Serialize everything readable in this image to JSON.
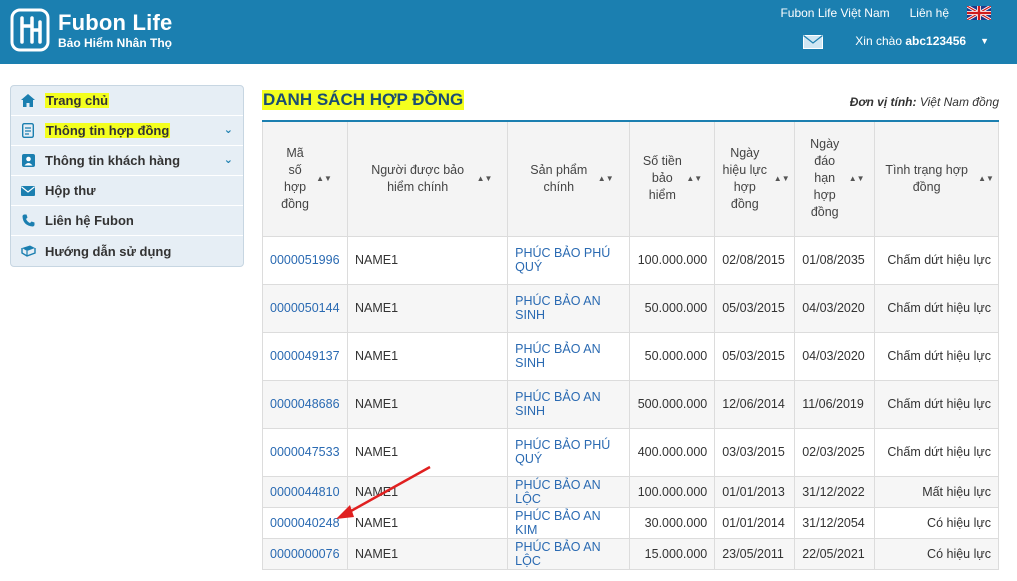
{
  "header": {
    "brand": "Fubon Life",
    "tagline": "Bảo Hiểm Nhân Thọ",
    "company_link": "Fubon Life Việt Nam",
    "contact_link": "Liên hệ",
    "greeting": "Xin chào",
    "username": "abc123456",
    "icons": {
      "logo": "fubon-logo",
      "flag": "uk-flag-icon",
      "mail": "mail-icon",
      "dropdown": "caret-down-icon"
    }
  },
  "sidebar": {
    "items": [
      {
        "label": "Trang chủ",
        "icon": "home-icon"
      },
      {
        "label": "Thông tin hợp đồng",
        "icon": "document-icon"
      },
      {
        "label": "Thông tin khách hàng",
        "icon": "user-icon"
      },
      {
        "label": "Hộp thư",
        "icon": "mail-icon"
      },
      {
        "label": "Liên hệ Fubon",
        "icon": "phone-icon"
      },
      {
        "label": "Hướng dẫn sử dụng",
        "icon": "book-icon"
      }
    ]
  },
  "main": {
    "title": "DANH SÁCH HỢP ĐỒNG",
    "unit_label": "Đơn vị tính:",
    "unit_value": "Việt Nam đồng"
  },
  "table": {
    "columns": [
      "Mã số hợp đồng",
      "Người được bảo hiểm chính",
      "Sản phẩm chính",
      "Số tiền bảo hiểm",
      "Ngày hiệu lực hợp đồng",
      "Ngày đáo hạn hợp đồng",
      "Tình trạng hợp đồng"
    ],
    "rows": [
      [
        "0000051996",
        "NAME1",
        "PHÚC BẢO PHÚ QUÝ",
        "100.000.000",
        "02/08/2015",
        "01/08/2035",
        "Chấm dứt hiệu lực"
      ],
      [
        "0000050144",
        "NAME1",
        "PHÚC BẢO AN SINH",
        "50.000.000",
        "05/03/2015",
        "04/03/2020",
        "Chấm dứt hiệu lực"
      ],
      [
        "0000049137",
        "NAME1",
        "PHÚC BẢO AN SINH",
        "50.000.000",
        "05/03/2015",
        "04/03/2020",
        "Chấm dứt hiệu lực"
      ],
      [
        "0000048686",
        "NAME1",
        "PHÚC BẢO AN SINH",
        "500.000.000",
        "12/06/2014",
        "11/06/2019",
        "Chấm dứt hiệu lực"
      ],
      [
        "0000047533",
        "NAME1",
        "PHÚC BẢO PHÚ QUÝ",
        "400.000.000",
        "03/03/2015",
        "02/03/2025",
        "Chấm dứt hiệu lực"
      ],
      [
        "0000044810",
        "NAME1",
        "PHÚC BẢO AN LỘC",
        "100.000.000",
        "01/01/2013",
        "31/12/2022",
        "Mất hiệu lực"
      ],
      [
        "0000040248",
        "NAME1",
        "PHÚC BẢO AN KIM",
        "30.000.000",
        "01/01/2014",
        "31/12/2054",
        "Có hiệu lực"
      ],
      [
        "0000000076",
        "NAME1",
        "PHÚC BẢO AN LỘC",
        "15.000.000",
        "23/05/2011",
        "22/05/2021",
        "Có hiệu lực"
      ]
    ]
  },
  "annotation": {
    "arrow_color": "#e02020",
    "icon": "red-arrow-annotation"
  },
  "colors": {
    "header_bg": "#1b7fb0",
    "highlight": "#f4ff1e",
    "link": "#2a6ab2"
  }
}
